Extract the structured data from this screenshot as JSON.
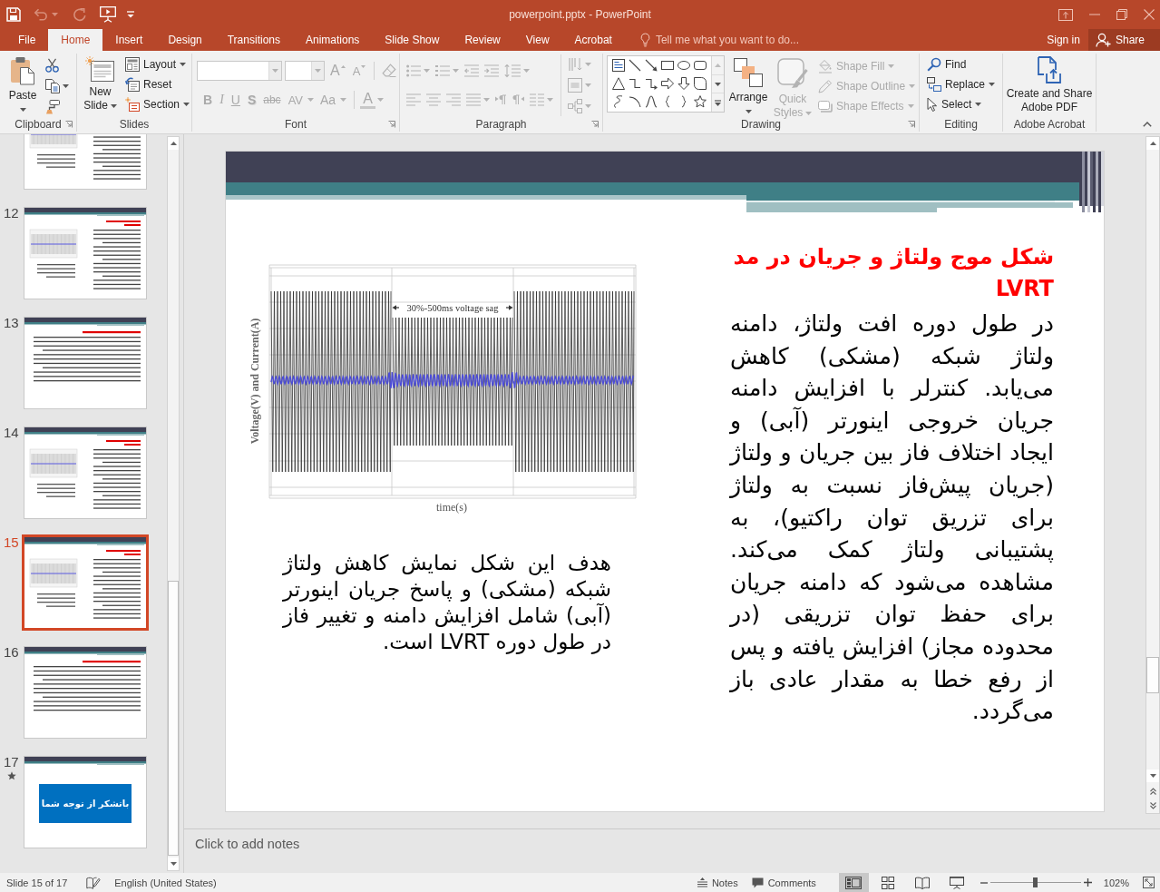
{
  "quick_access": [
    {
      "kind": "save",
      "disabled": false
    },
    {
      "kind": "undo",
      "disabled": true
    },
    {
      "kind": "redo",
      "disabled": true
    },
    {
      "kind": "present",
      "disabled": false
    },
    {
      "kind": "customize",
      "disabled": false
    }
  ],
  "window": {
    "title": "powerpoint.pptx - PowerPoint"
  },
  "tabs": [
    {
      "label": "File",
      "selected": false
    },
    {
      "label": "Home",
      "selected": true
    },
    {
      "label": "Insert",
      "selected": false
    },
    {
      "label": "Design",
      "selected": false
    },
    {
      "label": "Transitions",
      "selected": false
    },
    {
      "label": "Animations",
      "selected": false
    },
    {
      "label": "Slide Show",
      "selected": false
    },
    {
      "label": "Review",
      "selected": false
    },
    {
      "label": "View",
      "selected": false
    },
    {
      "label": "Acrobat",
      "selected": false
    }
  ],
  "tell_me": {
    "placeholder": "Tell me what you want to do..."
  },
  "account": {
    "sign_in": "Sign in",
    "share": "Share"
  },
  "ribbon": [
    {
      "kind": "clipboard",
      "label": "Clipboard",
      "launcher": true,
      "items": [
        {
          "kind": "paste",
          "label": "Paste",
          "disabled": false
        },
        {
          "kind": "cut",
          "disabled": false
        },
        {
          "kind": "copy",
          "disabled": false
        },
        {
          "kind": "format_painter",
          "disabled": false
        }
      ]
    },
    {
      "kind": "slides",
      "label": "Slides",
      "launcher": false,
      "items": [
        {
          "kind": "new_slide",
          "label": "New Slide",
          "disabled": false
        },
        {
          "kind": "layout",
          "label": "Layout",
          "disabled": false
        },
        {
          "kind": "reset",
          "label": "Reset",
          "disabled": false
        },
        {
          "kind": "section",
          "label": "Section",
          "disabled": false
        }
      ]
    },
    {
      "kind": "font",
      "label": "Font",
      "launcher": true,
      "items": [
        {
          "kind": "font_name",
          "disabled": true
        },
        {
          "kind": "font_size",
          "disabled": true
        },
        {
          "kind": "grow",
          "label": "A",
          "disabled": true
        },
        {
          "kind": "shrink",
          "label": "A",
          "disabled": true
        },
        {
          "kind": "clear",
          "disabled": true
        },
        {
          "kind": "bold",
          "label": "B",
          "disabled": true
        },
        {
          "kind": "italic",
          "label": "I",
          "disabled": true
        },
        {
          "kind": "underline",
          "label": "U",
          "disabled": true
        },
        {
          "kind": "shadow",
          "label": "S",
          "disabled": true
        },
        {
          "kind": "strike",
          "label": "abc",
          "disabled": true
        },
        {
          "kind": "spacing",
          "label": "AV",
          "disabled": true
        },
        {
          "kind": "case",
          "label": "Aa",
          "disabled": true
        },
        {
          "kind": "color",
          "label": "A",
          "disabled": true
        }
      ]
    },
    {
      "kind": "paragraph",
      "label": "Paragraph",
      "launcher": true,
      "items": [
        {
          "kind": "bullets",
          "disabled": true
        },
        {
          "kind": "numbering",
          "disabled": true
        },
        {
          "kind": "decrease_indent",
          "disabled": true
        },
        {
          "kind": "increase_indent",
          "disabled": true
        },
        {
          "kind": "line_spacing",
          "disabled": true
        },
        {
          "kind": "align_left",
          "disabled": true
        },
        {
          "kind": "align_center",
          "disabled": true
        },
        {
          "kind": "align_right",
          "disabled": true
        },
        {
          "kind": "justify",
          "disabled": true
        },
        {
          "kind": "ltr",
          "disabled": true
        },
        {
          "kind": "rtl",
          "disabled": true
        },
        {
          "kind": "columns",
          "disabled": true
        },
        {
          "kind": "text_direction",
          "disabled": true
        },
        {
          "kind": "align_text",
          "disabled": true
        },
        {
          "kind": "smartart",
          "disabled": true
        }
      ]
    },
    {
      "kind": "drawing",
      "label": "Drawing",
      "launcher": true,
      "items": [
        {
          "kind": "shapes",
          "disabled": false
        },
        {
          "kind": "arrange",
          "label": "Arrange",
          "disabled": false
        },
        {
          "kind": "quick_styles",
          "label": "Quick Styles",
          "disabled": true
        },
        {
          "kind": "shape_fill",
          "label": "Shape Fill",
          "disabled": true
        },
        {
          "kind": "shape_outline",
          "label": "Shape Outline",
          "disabled": true
        },
        {
          "kind": "shape_effects",
          "label": "Shape Effects",
          "disabled": true
        }
      ]
    },
    {
      "kind": "editing",
      "label": "Editing",
      "launcher": false,
      "items": [
        {
          "kind": "find",
          "label": "Find",
          "disabled": false
        },
        {
          "kind": "replace",
          "label": "Replace",
          "disabled": false
        },
        {
          "kind": "select",
          "label": "Select",
          "disabled": false
        }
      ]
    },
    {
      "kind": "acrobat",
      "label": "Adobe Acrobat",
      "launcher": false,
      "items": [
        {
          "kind": "create_pdf",
          "label": "Create and Share Adobe PDF",
          "disabled": false
        }
      ]
    }
  ],
  "thumbnails": [
    {
      "kind": "chart",
      "selected": false,
      "animated": false
    },
    {
      "number": "12",
      "kind": "chart",
      "selected": false,
      "animated": false
    },
    {
      "number": "13",
      "kind": "text",
      "selected": false,
      "animated": false
    },
    {
      "number": "14",
      "kind": "chart",
      "selected": false,
      "animated": false
    },
    {
      "number": "15",
      "kind": "chart",
      "selected": true,
      "animated": false
    },
    {
      "number": "16",
      "kind": "text",
      "selected": false,
      "animated": false
    },
    {
      "number": "17",
      "kind": "closing",
      "selected": false,
      "animated": true,
      "text": "باتشکر از توجه شما"
    }
  ],
  "slide": {
    "title": "شکل موج ولتاژ و جریان در مد LVRT",
    "body": "در طول دوره افت ولتاژ، دامنه ولتاژ شبکه (مشکی) کاهش می‌یابد. کنترلر با افزایش دامنه جریان خروجی اینورتر (آبی) و ایجاد اختلاف فاز بین جریان و ولتاژ (جریان پیش‌فاز نسبت به ولتاژ برای تزریق توان راکتیو)، به پشتیبانی ولتاژ کمک می‌کند. مشاهده می‌شود که دامنه جریان برای حفظ توان تزریقی (در محدوده مجاز) افزایش یافته و پس از رفع خطا به مقدار عادی باز می‌گردد.",
    "figure": {
      "ylabel": "Voltage(V) and Current(A)",
      "xlabel": "time(s)",
      "annotation": "30%-500ms voltage sag"
    },
    "caption": "هدف این شکل نمایش کاهش ولتاژ شبکه (مشکی) و پاسخ جریان اینورتر (آبی) شامل افزایش دامنه و تغییر فاز در طول دوره LVRT است."
  },
  "notes": {
    "placeholder": "Click to add notes"
  },
  "status": {
    "slide_indicator": "Slide 15 of 17",
    "language": "English (United States)",
    "notes": "Notes",
    "comments": "Comments",
    "views": [
      {
        "kind": "normal",
        "selected": true
      },
      {
        "kind": "sorter",
        "selected": false
      },
      {
        "kind": "reading",
        "selected": false
      },
      {
        "kind": "slideshow",
        "selected": false
      }
    ],
    "zoom": {
      "level": 0.5,
      "reading": "102%"
    }
  }
}
